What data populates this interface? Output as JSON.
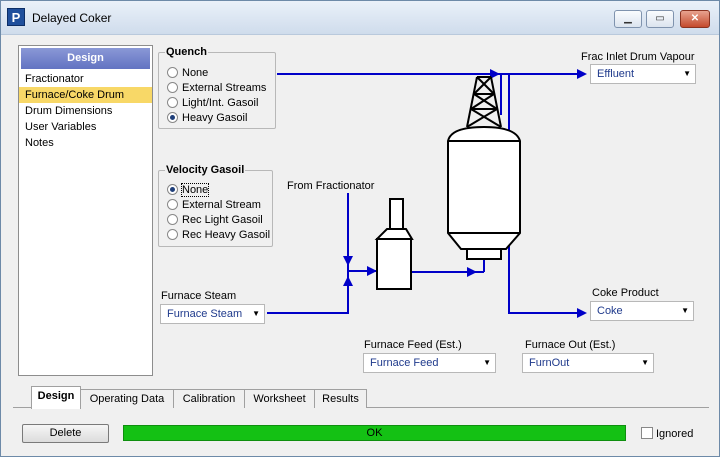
{
  "window": {
    "title": "Delayed Coker",
    "icon_letter": "P"
  },
  "nav": {
    "header": "Design",
    "items": [
      "Fractionator",
      "Furnace/Coke Drum",
      "Drum Dimensions",
      "User Variables",
      "Notes"
    ],
    "selected": "Furnace/Coke Drum"
  },
  "quench": {
    "title": "Quench",
    "options": [
      "None",
      "External Streams",
      "Light/Int. Gasoil",
      "Heavy Gasoil"
    ],
    "selected": "Heavy Gasoil"
  },
  "velocity": {
    "title": "Velocity Gasoil",
    "options": [
      "None",
      "External Stream",
      "Rec Light Gasoil",
      "Rec Heavy Gasoil"
    ],
    "selected": "None"
  },
  "diagram": {
    "from_fractionator": "From Fractionator",
    "frac_inlet_label": "Frac Inlet Drum Vapour",
    "frac_inlet_value": "Effluent",
    "furnace_steam_label": "Furnace Steam",
    "furnace_steam_value": "Furnace Steam",
    "coke_label": "Coke Product",
    "coke_value": "Coke",
    "furnace_feed_label": "Furnace Feed (Est.)",
    "furnace_feed_value": "Furnace Feed",
    "furnace_out_label": "Furnace Out (Est.)",
    "furnace_out_value": "FurnOut",
    "line_color": "#0000c8"
  },
  "tabs": [
    "Design",
    "Operating Data",
    "Calibration",
    "Worksheet",
    "Results"
  ],
  "active_tab": "Design",
  "footer": {
    "delete_label": "Delete",
    "status_text": "OK",
    "status_color": "#14c114",
    "ignored_label": "Ignored"
  }
}
